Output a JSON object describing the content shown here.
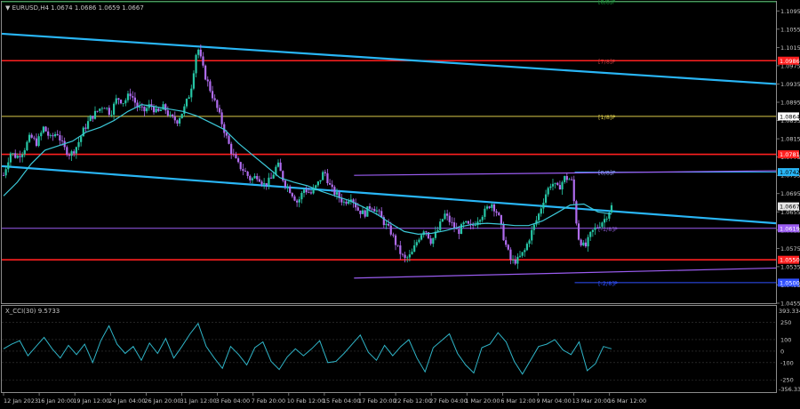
{
  "window": {
    "title": "EURUSD,H4  1.0674 1.0686 1.0659 1.0667",
    "indicator_title": "X_CCI(30) 9.5733"
  },
  "colors": {
    "background": "#000000",
    "axis": "#8c8c8c",
    "bull_candle": "#26c6a5",
    "bear_candle": "#b06cf0",
    "trend_line": "#29b6f6",
    "ma_line": "#3cc8d8",
    "support_red": "#ff2020",
    "murray_yellow": "#d8c84a",
    "channel_purple": "#9a5cf0",
    "cci_line": "#2fb5c8",
    "price_tag_bg": "#ffffff",
    "current_tag_bg": "#e6e6e6"
  },
  "price_axis": {
    "min": 1.0455,
    "max": 1.1115,
    "ticks": [
      "1.1095",
      "1.1055",
      "1.1015",
      "1.0975",
      "1.0935",
      "1.0895",
      "1.0855",
      "1.0815",
      "1.0775",
      "1.0735",
      "1.0695",
      "1.0655",
      "1.0615",
      "1.0575",
      "1.0535",
      "1.0495",
      "1.0455"
    ]
  },
  "price_labels": {
    "r1": "1.0986",
    "r2": "1.0864",
    "r3": "1.0781",
    "r4": "1.0742",
    "current": "1.0667",
    "r5": "1.0619",
    "s1": "1.0550",
    "s2": "1.0500"
  },
  "murray_labels": {
    "top": "[8/8]P",
    "l1": "[7/8]P",
    "l2": "[1/8]P",
    "l3": "[0/8]P",
    "l4": "[-1/8]P",
    "l5": "[-2/8]P"
  },
  "time_axis": {
    "labels": [
      "12 Jan 2023",
      "16 Jan 20:00",
      "19 Jan 12:00",
      "24 Jan 04:00",
      "26 Jan 20:00",
      "31 Jan 12:00",
      "3 Feb 04:00",
      "7 Feb 20:00",
      "10 Feb 12:00",
      "15 Feb 04:00",
      "17 Feb 20:00",
      "22 Feb 12:00",
      "27 Feb 04:00",
      "1 Mar 20:00",
      "6 Mar 12:00",
      "9 Mar 04:00",
      "13 Mar 20:00",
      "16 Mar 12:00"
    ]
  },
  "cci_axis": {
    "top": "393.3341",
    "ticks": [
      "250",
      "100",
      "0",
      "-100",
      "-250"
    ],
    "bottom": "-356.3357"
  },
  "chart_data": {
    "type": "candlestick",
    "symbol": "EURUSD",
    "timeframe": "H4",
    "ylim": [
      1.0455,
      1.1115
    ],
    "close_path": [
      1.0735,
      1.0785,
      1.0775,
      1.079,
      1.082,
      1.0805,
      1.084,
      1.0815,
      1.083,
      1.0795,
      1.078,
      1.08,
      1.0835,
      1.086,
      1.0875,
      1.089,
      1.087,
      1.0905,
      1.0895,
      1.0915,
      1.0885,
      1.0875,
      1.089,
      1.087,
      1.0885,
      1.086,
      1.0855,
      1.088,
      1.092,
      1.102,
      1.096,
      1.092,
      1.088,
      1.0835,
      1.079,
      1.076,
      1.0745,
      1.0725,
      1.0735,
      1.0715,
      1.0725,
      1.076,
      1.072,
      1.07,
      1.0675,
      1.0705,
      1.0695,
      1.0715,
      1.0745,
      1.0705,
      1.069,
      1.0675,
      1.069,
      1.066,
      1.065,
      1.067,
      1.0655,
      1.063,
      1.061,
      1.0575,
      1.055,
      1.056,
      1.0595,
      1.062,
      1.059,
      1.0615,
      1.065,
      1.063,
      1.061,
      1.063,
      1.062,
      1.064,
      1.0655,
      1.0675,
      1.065,
      1.059,
      1.0545,
      1.055,
      1.057,
      1.061,
      1.0645,
      1.069,
      1.072,
      1.0705,
      1.073,
      1.0725,
      1.06,
      1.0575,
      1.061,
      1.0625,
      1.064,
      1.0667
    ],
    "moving_average": [
      1.069,
      1.072,
      1.076,
      1.079,
      1.08,
      1.081,
      1.083,
      1.084,
      1.0855,
      1.0875,
      1.089,
      1.0885,
      1.088,
      1.0875,
      1.0865,
      1.085,
      1.0835,
      1.0805,
      1.078,
      1.0755,
      1.073,
      1.072,
      1.0712,
      1.07,
      1.069,
      1.068,
      1.0666,
      1.065,
      1.063,
      1.0612,
      1.0606,
      1.0608,
      1.0614,
      1.0622,
      1.0628,
      1.063,
      1.0628,
      1.0625,
      1.0625,
      1.0635,
      1.0652,
      1.067,
      1.0672,
      1.0655,
      1.065
    ],
    "trend_lines": [
      {
        "from": [
          0.0,
          1.1045
        ],
        "to": [
          1.0,
          1.0935
        ]
      },
      {
        "from": [
          0.0,
          1.0755
        ],
        "to": [
          1.0,
          1.063
        ]
      }
    ],
    "horizontal_levels": [
      {
        "price": 1.1115,
        "color": "green"
      },
      {
        "price": 1.0986,
        "color": "red"
      },
      {
        "price": 1.0864,
        "color": "yellow"
      },
      {
        "price": 1.0781,
        "color": "red"
      },
      {
        "price": 1.0742,
        "color": "cyan",
        "from": 0.74
      },
      {
        "price": 1.0619,
        "color": "purple"
      },
      {
        "price": 1.055,
        "color": "red"
      },
      {
        "price": 1.05,
        "color": "blue",
        "from": 0.74
      }
    ],
    "channel": [
      {
        "from": [
          0.455,
          1.0735
        ],
        "to": [
          1.0,
          1.0745
        ]
      },
      {
        "from": [
          0.455,
          1.051
        ],
        "to": [
          1.0,
          1.0532
        ]
      }
    ],
    "cci": {
      "name": "X_CCI(30)",
      "last": 9.5733,
      "ylim": [
        -356.3357,
        393.3341
      ],
      "values": [
        20,
        60,
        90,
        -40,
        40,
        120,
        20,
        -60,
        50,
        -30,
        60,
        -100,
        90,
        220,
        60,
        -20,
        40,
        -80,
        70,
        -20,
        110,
        -60,
        40,
        150,
        240,
        40,
        -60,
        -150,
        40,
        -30,
        -120,
        30,
        80,
        -90,
        -160,
        -50,
        20,
        -40,
        20,
        90,
        -100,
        -90,
        -20,
        60,
        140,
        -10,
        -80,
        50,
        -40,
        40,
        100,
        -60,
        -180,
        30,
        90,
        150,
        -20,
        -120,
        -190,
        30,
        60,
        160,
        80,
        -90,
        -200,
        -80,
        40,
        60,
        100,
        10,
        -30,
        80,
        -170,
        -110,
        40,
        20
      ]
    }
  }
}
